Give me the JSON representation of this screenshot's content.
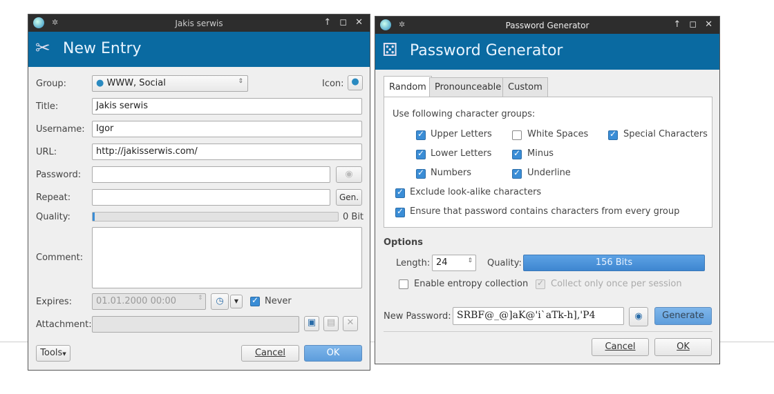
{
  "entry": {
    "window_title": "Jakis serwis",
    "banner_title": "New Entry",
    "labels": {
      "group": "Group:",
      "icon": "Icon:",
      "title": "Title:",
      "username": "Username:",
      "url": "URL:",
      "password": "Password:",
      "repeat": "Repeat:",
      "quality": "Quality:",
      "comment": "Comment:",
      "expires": "Expires:",
      "attachment": "Attachment:"
    },
    "group_value": "WWW, Social",
    "title_value": "Jakis serwis",
    "username_value": "Igor",
    "url_value": "http://jakisserwis.com/",
    "password_value": "",
    "repeat_value": "",
    "gen_label": "Gen.",
    "quality_text": "0 Bit",
    "quality_percent": 0,
    "comment_value": "",
    "expires_value": "01.01.2000 00:00",
    "never_label": "Never",
    "never_checked": true,
    "tools_label": "Tools",
    "cancel_label": "Cancel",
    "ok_label": "OK"
  },
  "generator": {
    "window_title": "Password Generator",
    "banner_title": "Password Generator",
    "tabs": [
      {
        "label": "Random",
        "active": true
      },
      {
        "label": "Pronounceable"
      },
      {
        "label": "Custom"
      }
    ],
    "groups_label": "Use following character groups:",
    "options_checks": [
      {
        "label": "Upper Letters",
        "checked": true
      },
      {
        "label": "White Spaces",
        "checked": false
      },
      {
        "label": "Special Characters",
        "checked": true
      },
      {
        "label": "Lower Letters",
        "checked": true
      },
      {
        "label": "Minus",
        "checked": true
      },
      {
        "label": "Numbers",
        "checked": true
      },
      {
        "label": "Underline",
        "checked": true
      }
    ],
    "exclude_label": "Exclude look-alike characters",
    "ensure_label": "Ensure that password contains characters from every group",
    "options_heading": "Options",
    "length_label": "Length:",
    "length_value": "24",
    "quality_label": "Quality:",
    "quality_text": "156 Bits",
    "entropy_label": "Enable entropy collection",
    "collect_label": "Collect only once per session",
    "new_password_label": "New Password:",
    "new_password_value": "SRBF@_@]aK@'i`aTk-h],'P4",
    "generate_label": "Generate",
    "cancel_label": "Cancel",
    "ok_label": "OK"
  }
}
